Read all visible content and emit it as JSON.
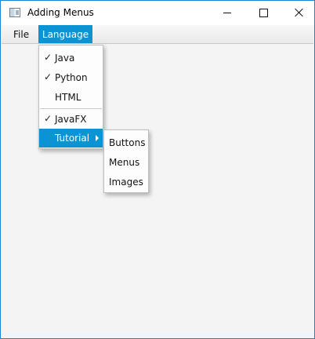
{
  "window": {
    "title": "Adding Menus",
    "accent_color": "#0c93d3"
  },
  "menubar": {
    "file_label": "File",
    "language_label": "Language"
  },
  "language_menu": {
    "items": [
      {
        "label": "Java",
        "checked": true
      },
      {
        "label": "Python",
        "checked": true
      },
      {
        "label": "HTML",
        "checked": false
      },
      {
        "label": "JavaFX",
        "checked": true
      },
      {
        "label": "Tutorial",
        "has_submenu": true,
        "highlighted": true
      }
    ],
    "check_glyph": "✓"
  },
  "tutorial_submenu": {
    "items": [
      {
        "label": "Buttons"
      },
      {
        "label": "Menus"
      },
      {
        "label": "Images"
      }
    ]
  }
}
